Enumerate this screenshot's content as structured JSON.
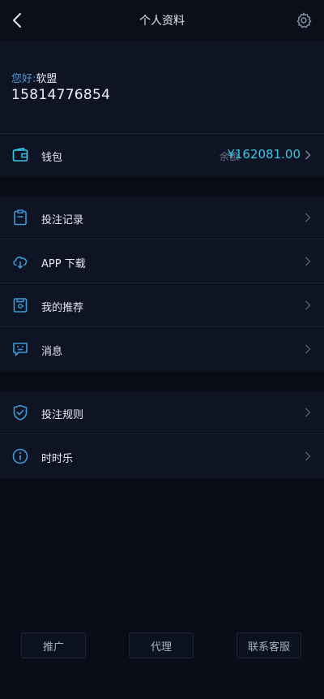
{
  "header": {
    "title": "个人资料",
    "back_icon": "chevron-left-icon",
    "settings_icon": "gear-icon"
  },
  "profile": {
    "greeting_label": "您好:",
    "name": "软盟",
    "phone": "15814776854"
  },
  "wallet": {
    "label": "钱包",
    "balance_label": "余额",
    "balance_value": "¥162081.00",
    "icon": "wallet-icon"
  },
  "menu_group_1": [
    {
      "label": "投注记录",
      "icon": "clipboard-icon"
    },
    {
      "label": "APP 下载",
      "icon": "cloud-download-icon"
    },
    {
      "label": "我的推荐",
      "icon": "recommend-icon"
    },
    {
      "label": "消息",
      "icon": "message-icon"
    }
  ],
  "menu_group_2": [
    {
      "label": "投注规则",
      "icon": "shield-check-icon"
    },
    {
      "label": "时时乐",
      "icon": "info-icon"
    }
  ],
  "footer": {
    "promote": "推广",
    "agent": "代理",
    "customer_service": "联系客服"
  },
  "colors": {
    "accent": "#38c8e8",
    "icon_blue": "#3a9bd8",
    "background": "#0a0d17",
    "panel": "#0f1424"
  }
}
